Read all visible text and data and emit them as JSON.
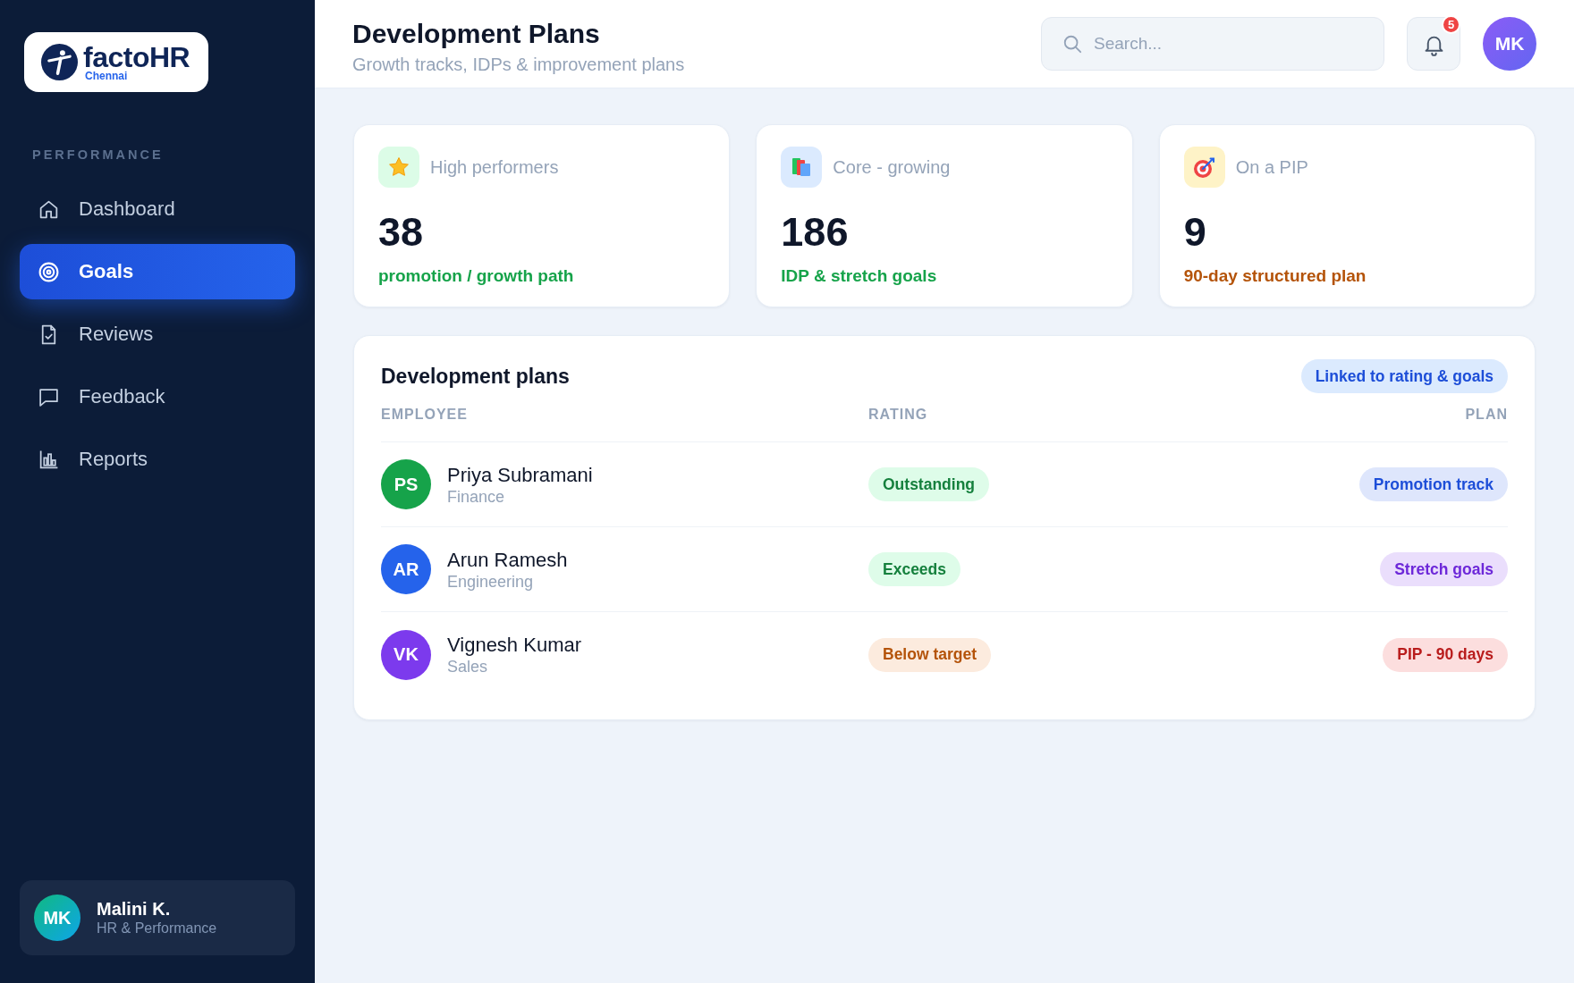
{
  "sidebar": {
    "logo": {
      "name": "factoHR",
      "location": "Chennai"
    },
    "section_label": "PERFORMANCE",
    "items": [
      {
        "label": "Dashboard",
        "selected": false
      },
      {
        "label": "Goals",
        "selected": true
      },
      {
        "label": "Reviews",
        "selected": false
      },
      {
        "label": "Feedback",
        "selected": false
      },
      {
        "label": "Reports",
        "selected": false
      }
    ],
    "user": {
      "initials": "MK",
      "name": "Malini K.",
      "role": "HR & Performance"
    }
  },
  "header": {
    "title": "Development Plans",
    "subtitle": "Growth tracks, IDPs & improvement plans",
    "search": {
      "placeholder": "Search..."
    },
    "notifications": {
      "count": "5"
    },
    "avatar": {
      "initials": "MK"
    }
  },
  "stats": [
    {
      "label": "High performers",
      "value": "38",
      "note": "promotion / growth path",
      "color": "#16a34a"
    },
    {
      "label": "Core - growing",
      "value": "186",
      "note": "IDP & stretch goals",
      "color": "#16a34a"
    },
    {
      "label": "On a PIP",
      "value": "9",
      "note": "90-day structured plan",
      "color": "#b45309"
    }
  ],
  "table": {
    "title": "Development plans",
    "tag": "Linked to rating & goals",
    "columns": [
      "EMPLOYEE",
      "RATING",
      "PLAN"
    ],
    "rows": [
      {
        "avatar": {
          "initials": "PS",
          "color": "#16a34a"
        },
        "name": "Priya Subramani",
        "department": "Finance",
        "rating": {
          "label": "Outstanding",
          "color": "#15803d"
        },
        "plan": {
          "label": "Promotion track",
          "color": "#1d4ed8"
        }
      },
      {
        "avatar": {
          "initials": "AR",
          "color": "#2563eb"
        },
        "name": "Arun Ramesh",
        "department": "Engineering",
        "rating": {
          "label": "Exceeds",
          "color": "#15803d"
        },
        "plan": {
          "label": "Stretch goals",
          "color": "#6d28d9"
        }
      },
      {
        "avatar": {
          "initials": "VK",
          "color": "#7c3aed"
        },
        "name": "Vignesh Kumar",
        "department": "Sales",
        "rating": {
          "label": "Below target",
          "color": "#b45309"
        },
        "plan": {
          "label": "PIP - 90 days",
          "color": "#b91c1c"
        }
      }
    ]
  }
}
